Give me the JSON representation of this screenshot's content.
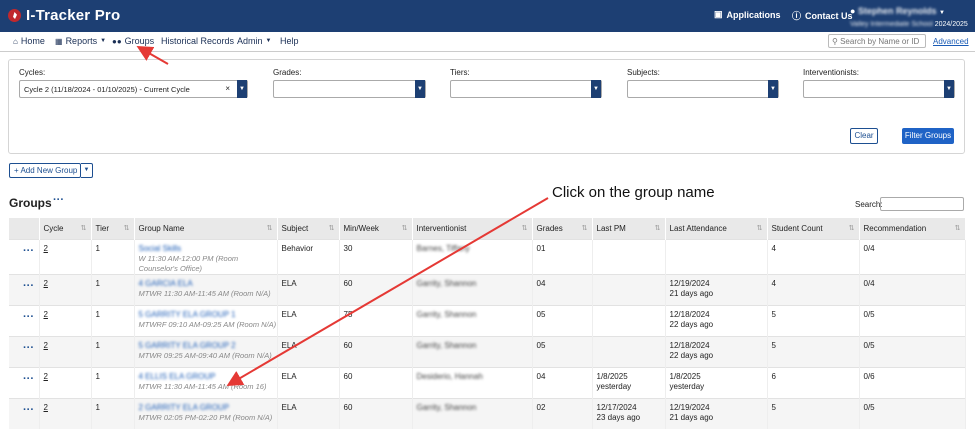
{
  "app": {
    "title": "I-Tracker Pro"
  },
  "topbar": {
    "applications": "Applications",
    "contact": "Contact Us",
    "user_name": "Stephen Reynolds",
    "user_school": "Valley Intermediate School",
    "user_year": "2024/2025"
  },
  "nav": {
    "home": "Home",
    "reports": "Reports",
    "groups": "Groups",
    "historical": "Historical Records",
    "admin": "Admin",
    "help": "Help",
    "search_placeholder": "Search by Name or ID",
    "advanced": "Advanced"
  },
  "filters": {
    "cycles_label": "Cycles:",
    "cycles_value": "Cycle 2 (11/18/2024 - 01/10/2025) - Current Cycle",
    "grades_label": "Grades:",
    "tiers_label": "Tiers:",
    "subjects_label": "Subjects:",
    "interventionists_label": "Interventionists:",
    "clear": "Clear",
    "filter": "Filter Groups"
  },
  "toolbar": {
    "add_group": "+ Add New Group"
  },
  "groups": {
    "title": "Groups",
    "search_label": "Search:"
  },
  "annotation": "Click on the group name",
  "colors": {
    "header": "#1d3f73",
    "accent": "#1f63c6",
    "arrow": "#e53935"
  },
  "table": {
    "columns": [
      "Cycle",
      "Tier",
      "Group Name",
      "Subject",
      "Min/Week",
      "Interventionist",
      "Grades",
      "Last PM",
      "Last Attendance",
      "Student Count",
      "Recommendation"
    ],
    "rows": [
      {
        "cycle": "2",
        "tier": "1",
        "name": "Social Skills",
        "schedule": "W 11:30 AM-12:00 PM (Room Counselor's Office)",
        "subject": "Behavior",
        "min": "30",
        "interventionist": "Barnes, Tiffany",
        "grades": "01",
        "pm": "",
        "pm2": "",
        "att": "",
        "att2": "",
        "count": "4",
        "rec": "0/4"
      },
      {
        "cycle": "2",
        "tier": "1",
        "name": "4 GARCIA ELA",
        "schedule": "MTWR 11:30 AM-11:45 AM (Room N/A)",
        "subject": "ELA",
        "min": "60",
        "interventionist": "Garrity, Shannon",
        "grades": "04",
        "pm": "",
        "pm2": "",
        "att": "12/19/2024",
        "att2": "21 days ago",
        "count": "4",
        "rec": "0/4"
      },
      {
        "cycle": "2",
        "tier": "1",
        "name": "5 GARRITY ELA GROUP 1",
        "schedule": "MTWRF 09:10 AM-09:25 AM (Room N/A)",
        "subject": "ELA",
        "min": "75",
        "interventionist": "Garrity, Shannon",
        "grades": "05",
        "pm": "",
        "pm2": "",
        "att": "12/18/2024",
        "att2": "22 days ago",
        "count": "5",
        "rec": "0/5"
      },
      {
        "cycle": "2",
        "tier": "1",
        "name": "5 GARRITY ELA GROUP 2",
        "schedule": "MTWR 09:25 AM-09:40 AM (Room N/A)",
        "subject": "ELA",
        "min": "60",
        "interventionist": "Garrity, Shannon",
        "grades": "05",
        "pm": "",
        "pm2": "",
        "att": "12/18/2024",
        "att2": "22 days ago",
        "count": "5",
        "rec": "0/5"
      },
      {
        "cycle": "2",
        "tier": "1",
        "name": "4 ELLIS ELA GROUP",
        "schedule": "MTWR 11:30 AM-11:45 AM (Room 16)",
        "subject": "ELA",
        "min": "60",
        "interventionist": "Desiderio, Hannah",
        "grades": "04",
        "pm": "1/8/2025",
        "pm2": "yesterday",
        "att": "1/8/2025",
        "att2": "yesterday",
        "count": "6",
        "rec": "0/6"
      },
      {
        "cycle": "2",
        "tier": "1",
        "name": "2 GARRITY ELA GROUP",
        "schedule": "MTWR 02:05 PM-02:20 PM (Room N/A)",
        "subject": "ELA",
        "min": "60",
        "interventionist": "Garrity, Shannon",
        "grades": "02",
        "pm": "12/17/2024",
        "pm2": "23 days ago",
        "att": "12/19/2024",
        "att2": "21 days ago",
        "count": "5",
        "rec": "0/5"
      }
    ]
  }
}
